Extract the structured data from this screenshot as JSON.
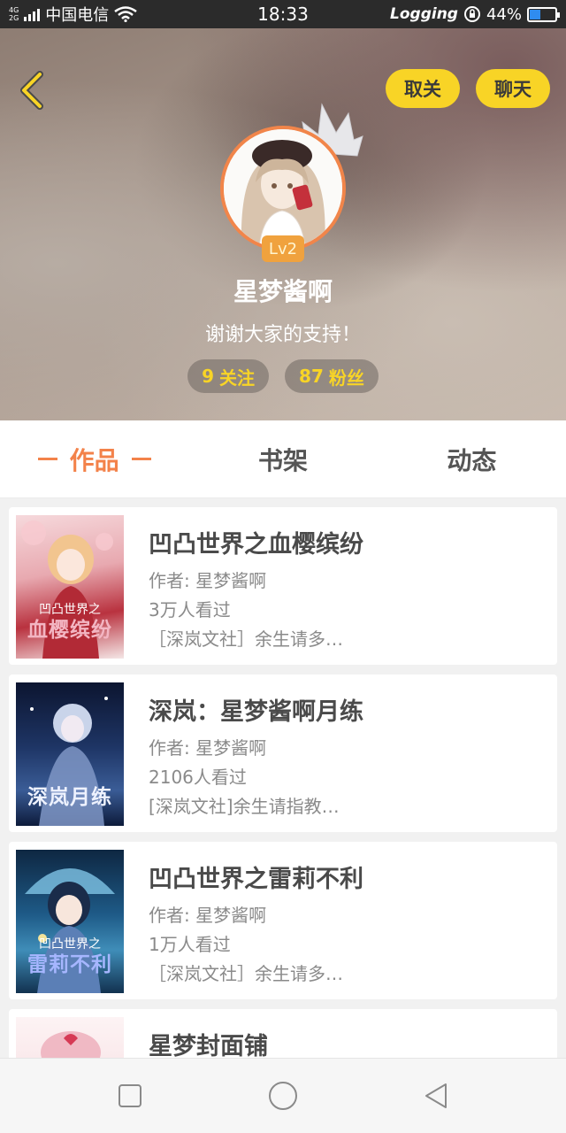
{
  "status_bar": {
    "network_top": "4G",
    "network_bottom": "2G",
    "carrier": "中国电信",
    "time": "18:33",
    "logging": "Logging",
    "battery": "44%",
    "battery_level": 0.44,
    "battery_color": "#2f8cf0"
  },
  "header": {
    "back_icon": "chevron-left-icon",
    "unfollow_label": "取关",
    "chat_label": "聊天",
    "level": "Lv2",
    "nickname": "星梦酱啊",
    "signature": "谢谢大家的支持！",
    "following_count": "9",
    "following_label": "关注",
    "followers_count": "87",
    "followers_label": "粉丝",
    "accent_color": "#f8d426"
  },
  "tabs": [
    {
      "label": "作品",
      "active": true
    },
    {
      "label": "书架",
      "active": false
    },
    {
      "label": "动态",
      "active": false
    }
  ],
  "books": [
    {
      "title": "凹凸世界之血樱缤纷",
      "author": "作者: 星梦酱啊",
      "views": "3万人看过",
      "tag": "［深岚文社］余生请多…",
      "cover_line1": "凹凸世界之",
      "cover_line2": "血樱缤纷"
    },
    {
      "title": "深岚：星梦酱啊月练",
      "author": "作者: 星梦酱啊",
      "views": "2106人看过",
      "tag": "[深岚文社]余生请指教…",
      "cover_line1": "",
      "cover_line2": "深岚月练"
    },
    {
      "title": "凹凸世界之雷莉不利",
      "author": "作者: 星梦酱啊",
      "views": "1万人看过",
      "tag": "［深岚文社］余生请多…",
      "cover_line1": "凹凸世界之",
      "cover_line2": "雷莉不利"
    },
    {
      "title": "星梦封面铺",
      "author": "",
      "views": "",
      "tag": "",
      "cover_line1": "",
      "cover_line2": ""
    }
  ],
  "nav": {
    "recents_icon": "square-icon",
    "home_icon": "circle-icon",
    "back_icon": "triangle-back-icon"
  }
}
